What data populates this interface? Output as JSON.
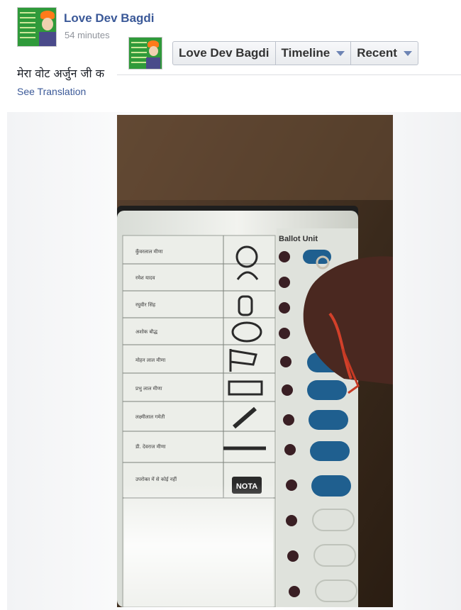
{
  "post": {
    "author": "Love Dev Bagdi",
    "timestamp": "54 minutes",
    "text": "मेरा वोट अर्जुन जी क",
    "see_translation": "See Translation"
  },
  "nav": {
    "name": "Love Dev Bagdi",
    "timeline_label": "Timeline",
    "recent_label": "Recent"
  },
  "photo": {
    "machine_label": "Ballot Unit",
    "nota_label": "NOTA",
    "candidates": [
      "कुँवरलाल मीणा",
      "रमेश यादव",
      "रघुवीर सिंह",
      "अशोक बौद्ध",
      "मोहन लाल मीणा",
      "प्रभु लाल मीणा",
      "लक्ष्मीलाल गमेती",
      "डी. देवराज मीणा",
      "उपरोक्त में से कोई नहीं"
    ]
  },
  "colors": {
    "link": "#3b5998",
    "accent_green": "#2f9a3a",
    "button_blue": "#1f5f8f"
  }
}
